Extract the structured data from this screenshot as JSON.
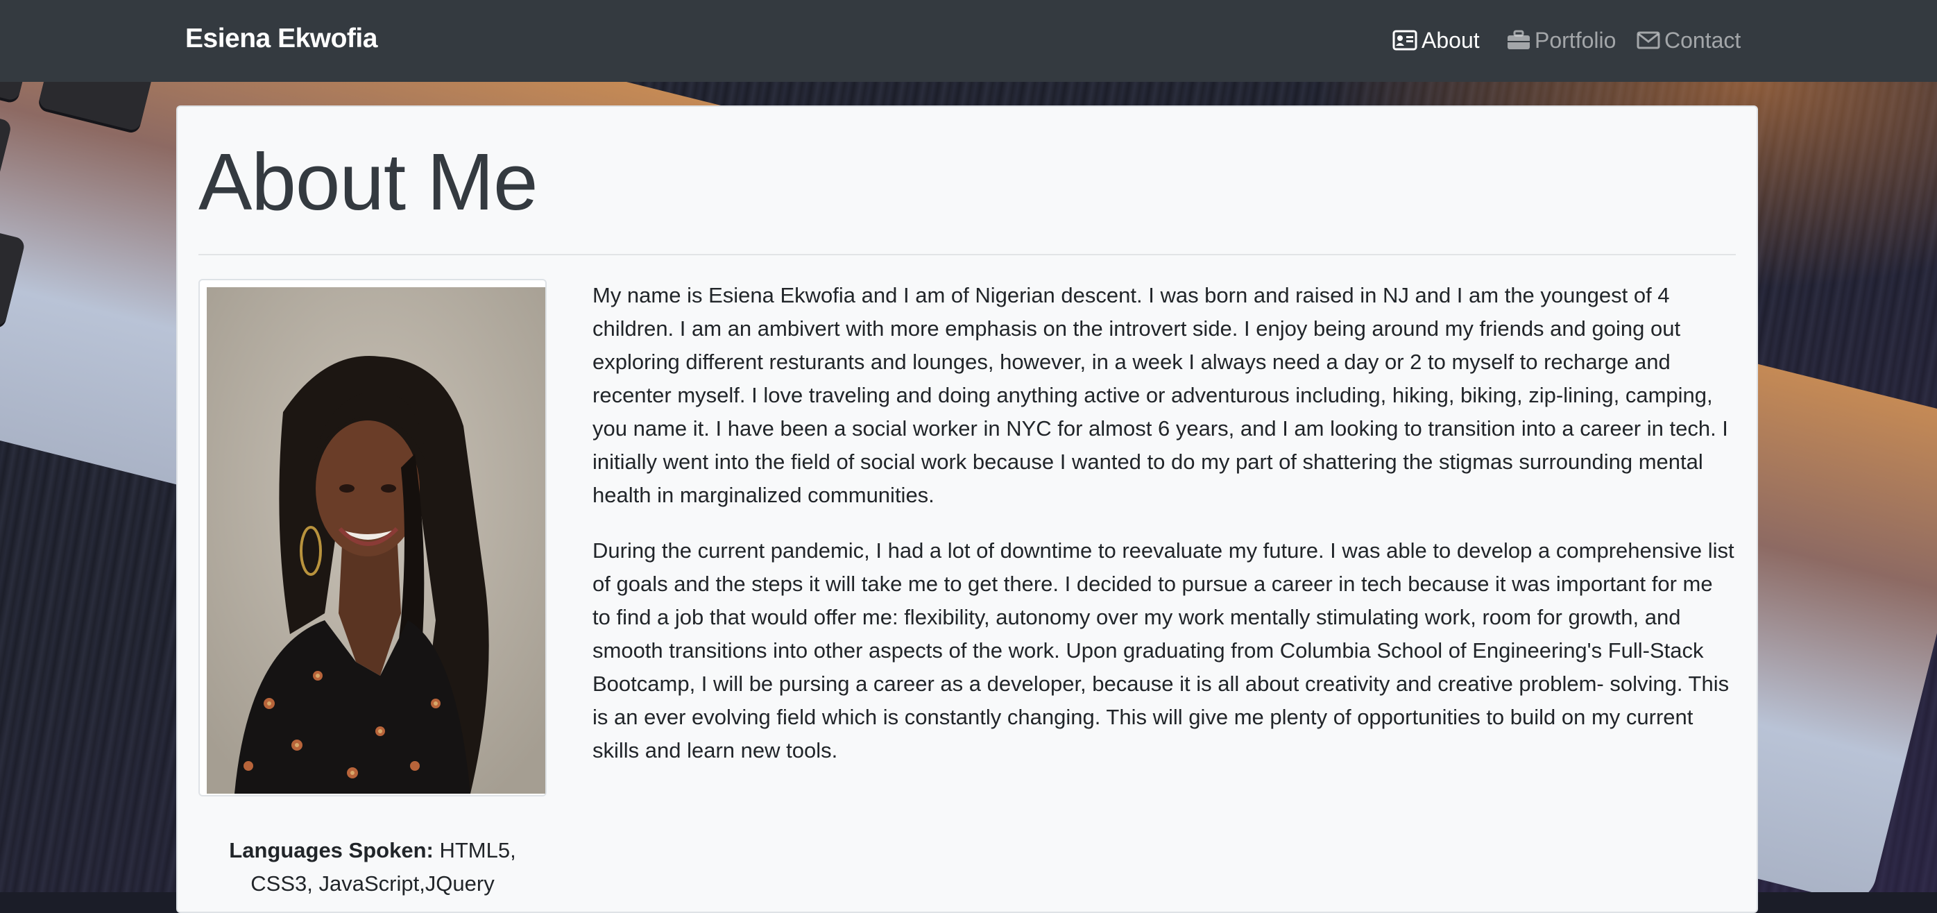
{
  "navbar": {
    "brand": "Esiena Ekwofia",
    "links": [
      {
        "label": "About",
        "icon": "id-card-icon",
        "active": true
      },
      {
        "label": "Portfolio",
        "icon": "briefcase-icon",
        "active": false
      },
      {
        "label": "Contact",
        "icon": "envelope-icon",
        "active": false
      }
    ]
  },
  "background": {
    "keys": [
      "ctrl"
    ]
  },
  "main": {
    "title": "About Me",
    "photo_alt": "Portrait of Esiena Ekwofia",
    "bio_paragraphs": [
      "My name is Esiena Ekwofia and I am of Nigerian descent. I was born and raised in NJ and I am the youngest of 4 children. I am an ambivert with more emphasis on the introvert side. I enjoy being around my friends and going out exploring different resturants and lounges, however, in a week I always need a day or 2 to myself to recharge and recenter myself. I love traveling and doing anything active or adventurous including, hiking, biking, zip-lining, camping, you name it. I have been a social worker in NYC for almost 6 years, and I am looking to transition into a career in tech. I initially went into the field of social work because I wanted to do my part of shattering the stigmas surrounding mental health in marginalized communities.",
      "During the current pandemic, I had a lot of downtime to reevaluate my future. I was able to develop a comprehensive list of goals and the steps it will take me to get there. I decided to pursue a career in tech because it was important for me to find a job that would offer me: flexibility, autonomy over my work mentally stimulating work, room for growth, and smooth transitions into other aspects of the work. Upon graduating from Columbia School of Engineering's Full-Stack Bootcamp, I will be pursing a career as a developer, because it is all about creativity and creative problem- solving. This is an ever evolving field which is constantly changing. This will give me plenty of opportunities to build on my current skills and learn new tools."
    ],
    "languages_label": "Languages Spoken:",
    "languages_value": "HTML5, CSS3, JavaScript,JQuery"
  },
  "colors": {
    "navbar_bg": "#343a40",
    "card_bg": "#f8f9fa",
    "text": "#212529"
  }
}
